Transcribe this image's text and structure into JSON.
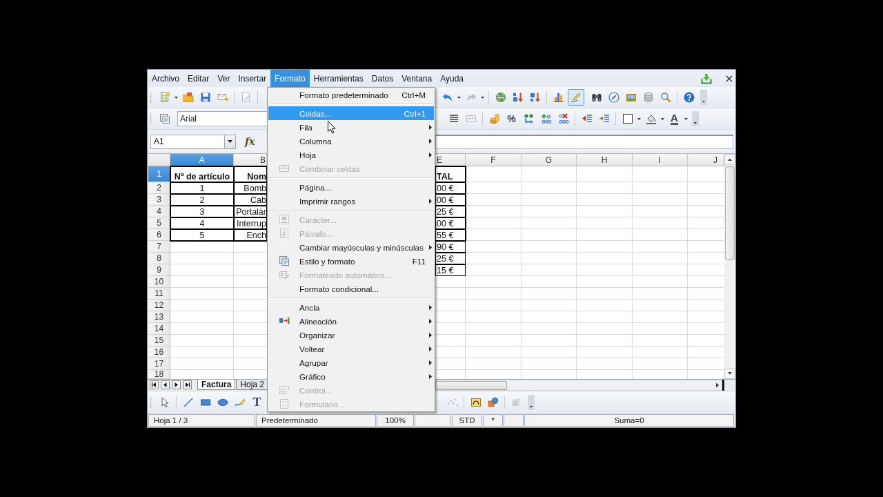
{
  "menu_bar": {
    "items": [
      {
        "label": "Archivo",
        "selected": false
      },
      {
        "label": "Editar",
        "selected": false
      },
      {
        "label": "Ver",
        "selected": false
      },
      {
        "label": "Insertar",
        "selected": false
      },
      {
        "label": "Formato",
        "selected": true
      },
      {
        "label": "Herramientas",
        "selected": false
      },
      {
        "label": "Datos",
        "selected": false
      },
      {
        "label": "Ventana",
        "selected": false
      },
      {
        "label": "Ayuda",
        "selected": false
      }
    ]
  },
  "open_menu": {
    "items": [
      {
        "kind": "item",
        "label": "Formato predeterminado",
        "shortcut": "Ctrl+M",
        "submenu": false,
        "disabled": false,
        "selected": false
      },
      {
        "kind": "separator"
      },
      {
        "kind": "item",
        "label": "Celdas...",
        "shortcut": "Ctrl+1",
        "submenu": false,
        "disabled": false,
        "selected": true
      },
      {
        "kind": "item",
        "label": "Fila",
        "submenu": true,
        "disabled": false,
        "selected": false
      },
      {
        "kind": "item",
        "label": "Columna",
        "submenu": true,
        "disabled": false,
        "selected": false
      },
      {
        "kind": "item",
        "label": "Hoja",
        "submenu": true,
        "disabled": false,
        "selected": false
      },
      {
        "kind": "item",
        "label": "Combinar celdas",
        "submenu": false,
        "disabled": true,
        "selected": false
      },
      {
        "kind": "separator"
      },
      {
        "kind": "item",
        "label": "Página...",
        "submenu": false,
        "disabled": false,
        "selected": false
      },
      {
        "kind": "item",
        "label": "Imprimir rangos",
        "submenu": true,
        "disabled": false,
        "selected": false
      },
      {
        "kind": "separator"
      },
      {
        "kind": "item",
        "label": "Carácter...",
        "submenu": false,
        "disabled": true,
        "selected": false
      },
      {
        "kind": "item",
        "label": "Párrafo...",
        "submenu": false,
        "disabled": true,
        "selected": false
      },
      {
        "kind": "item",
        "label": "Cambiar mayúsculas y minúsculas",
        "submenu": true,
        "disabled": false,
        "selected": false
      },
      {
        "kind": "item",
        "label": "Estilo y formato",
        "shortcut": "F11",
        "submenu": false,
        "disabled": false,
        "selected": false
      },
      {
        "kind": "item",
        "label": "Formateado automático...",
        "submenu": false,
        "disabled": true,
        "selected": false
      },
      {
        "kind": "item",
        "label": "Formato condicional...",
        "submenu": false,
        "disabled": false,
        "selected": false
      },
      {
        "kind": "separator"
      },
      {
        "kind": "item",
        "label": "Ancla",
        "submenu": true,
        "disabled": false,
        "selected": false
      },
      {
        "kind": "item",
        "label": "Alineación",
        "submenu": true,
        "disabled": false,
        "selected": false
      },
      {
        "kind": "item",
        "label": "Organizar",
        "submenu": true,
        "disabled": false,
        "selected": false
      },
      {
        "kind": "item",
        "label": "Voltear",
        "submenu": true,
        "disabled": false,
        "selected": false
      },
      {
        "kind": "item",
        "label": "Agrupar",
        "submenu": true,
        "disabled": false,
        "selected": false
      },
      {
        "kind": "item",
        "label": "Gráfico",
        "submenu": true,
        "disabled": false,
        "selected": false
      },
      {
        "kind": "item",
        "label": "Control...",
        "submenu": false,
        "disabled": true,
        "selected": false
      },
      {
        "kind": "item",
        "label": "Formulario...",
        "submenu": false,
        "disabled": true,
        "selected": false
      }
    ]
  },
  "standard_toolbar": {
    "buttons": [
      {
        "disabled": false,
        "pressed": false
      },
      {
        "disabled": false,
        "pressed": false
      },
      {
        "disabled": false,
        "pressed": false
      },
      {
        "disabled": false,
        "pressed": false
      },
      {
        "disabled": true,
        "pressed": false
      },
      {
        "disabled": false,
        "pressed": false
      },
      {
        "disabled": true,
        "pressed": false
      },
      {
        "disabled": false,
        "pressed": false
      },
      {
        "disabled": false,
        "pressed": false
      },
      {
        "disabled": false,
        "pressed": false
      },
      {
        "disabled": false,
        "pressed": false
      },
      {
        "disabled": false,
        "pressed": true
      },
      {
        "disabled": false,
        "pressed": false
      },
      {
        "disabled": false,
        "pressed": false
      },
      {
        "disabled": false,
        "pressed": false
      },
      {
        "disabled": false,
        "pressed": false
      },
      {
        "disabled": false,
        "pressed": false
      },
      {
        "disabled": false,
        "pressed": false
      }
    ]
  },
  "formatting_toolbar": {
    "font_name": "Arial",
    "buttons": [
      {
        "disabled": false
      },
      {
        "disabled": false
      },
      {
        "disabled": true
      },
      {
        "disabled": false
      },
      {
        "label": "%",
        "disabled": false
      },
      {
        "disabled": false
      },
      {
        "disabled": false
      },
      {
        "disabled": false
      },
      {
        "disabled": false
      },
      {
        "disabled": false
      },
      {
        "disabled": false
      },
      {
        "disabled": false
      },
      {
        "label": "A",
        "disabled": false
      }
    ]
  },
  "formula_bar": {
    "name_box": "A1",
    "function_wizard": "fx"
  },
  "sheet": {
    "columns": [
      {
        "label": "A",
        "selected": true
      },
      {
        "label": "B",
        "selected": false
      },
      {
        "label": "E",
        "selected": false
      },
      {
        "label": "F",
        "selected": false
      },
      {
        "label": "G",
        "selected": false
      },
      {
        "label": "H",
        "selected": false
      },
      {
        "label": "I",
        "selected": false
      },
      {
        "label": "J",
        "selected": false
      }
    ],
    "rows": [
      {
        "label": "1",
        "selected": true,
        "column_a": "Nº de artículo",
        "column_b": "Nom",
        "column_e": "TAL"
      },
      {
        "label": "2",
        "selected": false,
        "column_a": "1",
        "column_b": "Bomb",
        "column_e": "00 €"
      },
      {
        "label": "3",
        "selected": false,
        "column_a": "2",
        "column_b": "Cab",
        "column_e": "00 €"
      },
      {
        "label": "4",
        "selected": false,
        "column_a": "3",
        "column_b": "Portalár",
        "column_e": "25 €"
      },
      {
        "label": "5",
        "selected": false,
        "column_a": "4",
        "column_b": "Interrup",
        "column_e": "00 €"
      },
      {
        "label": "6",
        "selected": false,
        "column_a": "5",
        "column_b": "Ench",
        "column_e": "55 €"
      },
      {
        "label": "7",
        "selected": false,
        "column_e": "90 €"
      },
      {
        "label": "8",
        "selected": false,
        "column_e": "25 €"
      },
      {
        "label": "9",
        "selected": false,
        "column_e": "15 €"
      },
      {
        "label": "10",
        "selected": false
      },
      {
        "label": "11",
        "selected": false
      },
      {
        "label": "12",
        "selected": false
      },
      {
        "label": "13",
        "selected": false
      },
      {
        "label": "14",
        "selected": false
      },
      {
        "label": "15",
        "selected": false
      },
      {
        "label": "16",
        "selected": false
      },
      {
        "label": "17",
        "selected": false
      },
      {
        "label": "18",
        "selected": false
      }
    ]
  },
  "sheet_tabs": [
    {
      "label": "Factura",
      "selected": true
    },
    {
      "label": "Hoja 2",
      "selected": false
    }
  ],
  "drawing_toolbar": {
    "buttons": [
      {
        "disabled": false
      },
      {
        "disabled": false
      },
      {
        "disabled": false
      },
      {
        "disabled": false
      },
      {
        "disabled": false
      },
      {
        "label": "T",
        "disabled": false
      },
      {
        "disabled": true
      },
      {
        "disabled": false
      },
      {
        "disabled": false
      },
      {
        "disabled": true
      }
    ]
  },
  "status_bar": [
    {
      "kind": "text",
      "text": "Hoja 1 / 3"
    },
    {
      "kind": "text",
      "text": "Predeterminado"
    },
    {
      "kind": "text",
      "text": "100%"
    },
    {
      "kind": "blank"
    },
    {
      "kind": "text",
      "text": "STD"
    },
    {
      "kind": "text",
      "text": "*"
    },
    {
      "kind": "blank"
    },
    {
      "kind": "text",
      "text": "Suma=0"
    }
  ]
}
